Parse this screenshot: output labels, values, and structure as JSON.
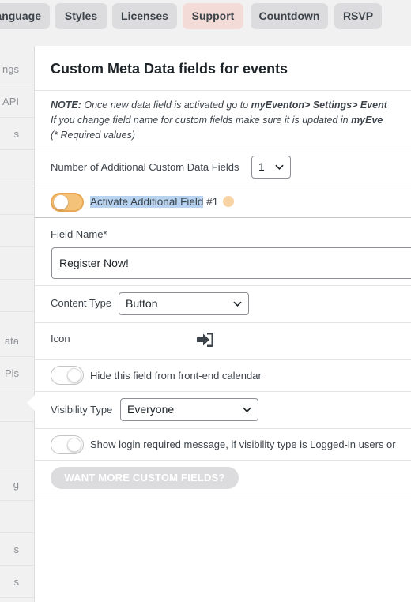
{
  "tabs": [
    {
      "label": "anguage",
      "active": false
    },
    {
      "label": "Styles",
      "active": false
    },
    {
      "label": "Licenses",
      "active": false
    },
    {
      "label": "Support",
      "active": true
    },
    {
      "label": "Countdown",
      "active": false
    },
    {
      "label": "RSVP",
      "active": false
    }
  ],
  "sidebar": {
    "items": [
      "ngs",
      "API",
      "s",
      "",
      "",
      "",
      "",
      "",
      "ata",
      "Pls",
      "",
      "",
      "g",
      "",
      "s",
      "s"
    ]
  },
  "panel": {
    "title": "Custom Meta Data fields for events",
    "note": {
      "prefix": "NOTE:",
      "line1_text": " Once new data field is activated go to ",
      "line1_bold": "myEventon> Settings> Event",
      "line2_text": "If you change field name for custom fields make sure it is updated in ",
      "line2_bold": "myEve",
      "line3": "(* Required values)"
    },
    "num_fields_label": "Number of Additional Custom Data Fields",
    "num_fields_value": "1",
    "activate": {
      "label_highlighted": "Activate Additional Field",
      "label_suffix": " #1",
      "enabled": true
    },
    "field_name": {
      "label": "Field Name*",
      "value": "Register Now!"
    },
    "content_type": {
      "label": "Content Type",
      "value": "Button"
    },
    "icon": {
      "label": "Icon",
      "icon_name": "sign-in-icon"
    },
    "hide_frontend": {
      "label": "Hide this field from front-end calendar",
      "enabled": false
    },
    "visibility": {
      "label": "Visibility Type",
      "value": "Everyone"
    },
    "login_msg": {
      "label": "Show login required message, if visibility type is Logged-in users or",
      "enabled": false
    },
    "more_button": "WANT MORE CUSTOM FIELDS?"
  },
  "colors": {
    "accent_active_tab": "#f3dcd7",
    "toggle_on": "#f5c27a",
    "selection_highlight": "#b7d3ef"
  }
}
